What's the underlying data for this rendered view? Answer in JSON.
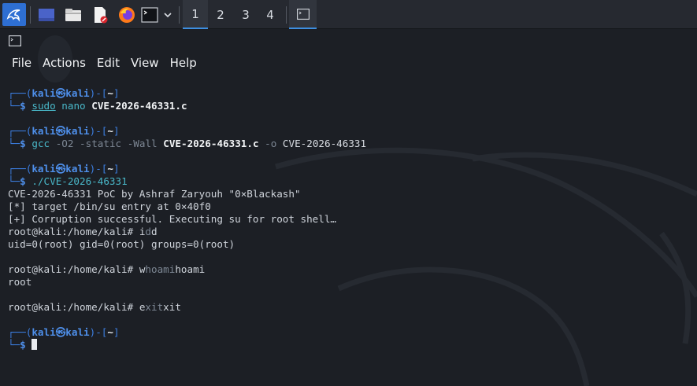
{
  "taskbar": {
    "workspaces": [
      "1",
      "2",
      "3",
      "4"
    ],
    "active_workspace": "1",
    "apps": [
      "kali-menu-icon",
      "show-desktop-icon",
      "file-manager-icon",
      "text-editor-icon",
      "firefox-icon",
      "terminal-icon"
    ],
    "running_task": "terminal-icon"
  },
  "window": {
    "menu": [
      "File",
      "Actions",
      "Edit",
      "View",
      "Help"
    ]
  },
  "prompt": {
    "open": "┌──(",
    "user": "kali",
    "at": "㉿",
    "host": "kali",
    "mid": ")-[",
    "dir": "~",
    "close": "]",
    "corner": "└─",
    "dollar": "$"
  },
  "commands": [
    {
      "program": "sudo",
      "rest": [
        {
          "text": " ",
          "style": "arg"
        },
        {
          "text": "nano",
          "style": "cmd"
        },
        {
          "text": " ",
          "style": "arg"
        },
        {
          "text": "CVE-2026-46331.c",
          "style": "arg-bold"
        }
      ]
    },
    {
      "program": "gcc",
      "rest": [
        {
          "text": " ",
          "style": "arg"
        },
        {
          "text": "-O2",
          "style": "flag"
        },
        {
          "text": " ",
          "style": "arg"
        },
        {
          "text": "-static",
          "style": "flag"
        },
        {
          "text": " ",
          "style": "arg"
        },
        {
          "text": "-Wall",
          "style": "flag"
        },
        {
          "text": " ",
          "style": "arg"
        },
        {
          "text": "CVE-2026-46331.c",
          "style": "arg-bold"
        },
        {
          "text": " ",
          "style": "arg"
        },
        {
          "text": "-o",
          "style": "flag"
        },
        {
          "text": " ",
          "style": "arg"
        },
        {
          "text": "CVE-2026-46331",
          "style": "arg"
        }
      ]
    },
    {
      "program": "./CVE-2026-46331",
      "rest": []
    }
  ],
  "output": {
    "poc_lines": [
      "CVE-2026-46331 PoC by Ashraf Zaryouh \"0×Blackash\"",
      "[*] target /bin/su entry at 0×40f0",
      "[+] Corruption successful. Executing su for root shell…"
    ],
    "root_prompt": "root@kali:/home/kali# ",
    "root_session": [
      {
        "echo_typed": "i",
        "echo_dim": "d",
        "echo_rest": "d",
        "result": "uid=0(root) gid=0(root) groups=0(root)"
      },
      {
        "echo_typed": "w",
        "echo_dim": "hoami",
        "echo_rest": "hoami",
        "result": "root"
      },
      {
        "echo_typed": "e",
        "echo_dim": "xit",
        "echo_rest": "xit",
        "result": ""
      }
    ]
  },
  "colors": {
    "background": "#1c1f25",
    "prompt_blue": "#4e8fea",
    "command_cyan": "#49b7c8",
    "flag_gray": "#7d8794",
    "text": "#ced3da",
    "accent": "#3d8ee0"
  }
}
